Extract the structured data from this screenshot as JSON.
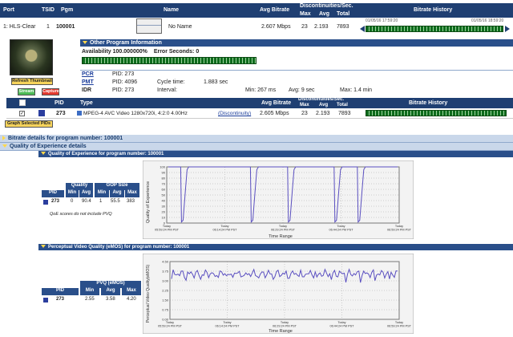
{
  "header": {
    "port": "Port",
    "tsid": "TSID",
    "pgm": "Pgm",
    "name": "Name",
    "avg_bitrate": "Avg Bitrate",
    "discontinuities": "Discontinuities/Sec.",
    "max": "Max",
    "avg": "Avg",
    "total": "Total",
    "bitrate_history": "Bitrate History"
  },
  "program_row": {
    "port": "1: HLS-Clear",
    "tsid": "1",
    "pgm": "100001",
    "name": "No Name",
    "bitrate": "2.607 Mbps",
    "max": "23",
    "avg": "2.193",
    "total": "7893",
    "hist_start": "01/05/16 17:59:20",
    "hist_end": "01/05/16 18:59:20"
  },
  "other_info": {
    "title": "Other Program Information",
    "availability": "Availability 100.000000%",
    "error_seconds": "Error Seconds: 0",
    "refresh_thumbnail": "Refresh Thumbnail",
    "stream_btn": "Stream",
    "capture_btn": "Capture",
    "pcr_label": "PCR",
    "pcr_value": "PID: 273",
    "pmt_label": "PMT",
    "pmt_value": "PID: 4096",
    "pmt_cycle": "Cycle time:",
    "pmt_cycle_val": "1.883 sec",
    "idr_label": "IDR",
    "idr_value": "PID: 273",
    "idr_interval": "Interval:",
    "idr_min": "Min: 267 ms",
    "idr_avg": "Avg: 9 sec",
    "idr_max": "Max: 1.4 min"
  },
  "pid_table": {
    "pid": "PID",
    "type": "Type",
    "avg_bitrate": "Avg Bitrate",
    "discontinuities": "Discontinuities/Sec.",
    "max": "Max",
    "avg": "Avg",
    "total": "Total",
    "bitrate_history": "Bitrate History",
    "row_pid": "273",
    "row_type": "MPEG-4 AVC Video 1280x720i, 4:2:0 4.00Hz",
    "row_disc_link": "(Discontinuity)",
    "row_bitrate": "2.605 Mbps",
    "row_max": "23",
    "row_avg": "2.193",
    "row_total": "7893",
    "graph_btn": "Graph Selected PIDs"
  },
  "bitrate_details": "Bitrate details for program number: 100001",
  "qoe_details": "Quality of Experience details",
  "qoe_section": {
    "title": "Quality of Experience for program number: 100001",
    "table": {
      "quality": "Quality",
      "gop_size": "GOP Size",
      "pid": "PID",
      "min": "Min",
      "avg": "Avg",
      "max": "Max",
      "row": {
        "pid": "273",
        "q_min": "0",
        "q_avg": "90.4",
        "g_min": "1",
        "g_avg": "55.5",
        "g_max": "383"
      },
      "note": "QoE scores do not include PVQ"
    },
    "y_label": "Quality of Experience",
    "x_label": "Time Range",
    "y_ticks": [
      "100",
      "90",
      "80",
      "70",
      "60",
      "50",
      "40",
      "30",
      "20",
      "10",
      "0"
    ],
    "x_ticks": [
      "Today\n05:59:24 PM PST",
      "Today\n06:14:24 PM PST",
      "Today\n06:29:24 PM PST",
      "Today\n06:44:24 PM PST",
      "Today\n06:59:24 PM PST"
    ]
  },
  "pvq_section": {
    "title": "Perceptual Video Quality (eMOS) for program number: 100001",
    "table": {
      "header": "PVQ (eMOS)",
      "pid": "PID",
      "min": "Min",
      "avg": "Avg",
      "max": "Max",
      "row": {
        "pid": "273",
        "min": "2.55",
        "avg": "3.58",
        "max": "4.20"
      }
    },
    "y_label": "Perceptual Video Quality(eMOS)",
    "x_label": "Time Range",
    "y_ticks": [
      "4.50",
      "3.75",
      "3.00",
      "2.25",
      "1.50",
      "0.75",
      "0.00"
    ],
    "x_ticks": [
      "Today\n05:59:24 PM PST",
      "Today\n06:14:24 PM PST",
      "Today\n06:29:24 PM PST",
      "Today\n06:44:24 PM PST",
      "Today\n06:59:24 PM PST"
    ]
  },
  "colors": {
    "header": "#1f3f72",
    "green": "#0d6b1c",
    "line": "#5a4fc0"
  }
}
